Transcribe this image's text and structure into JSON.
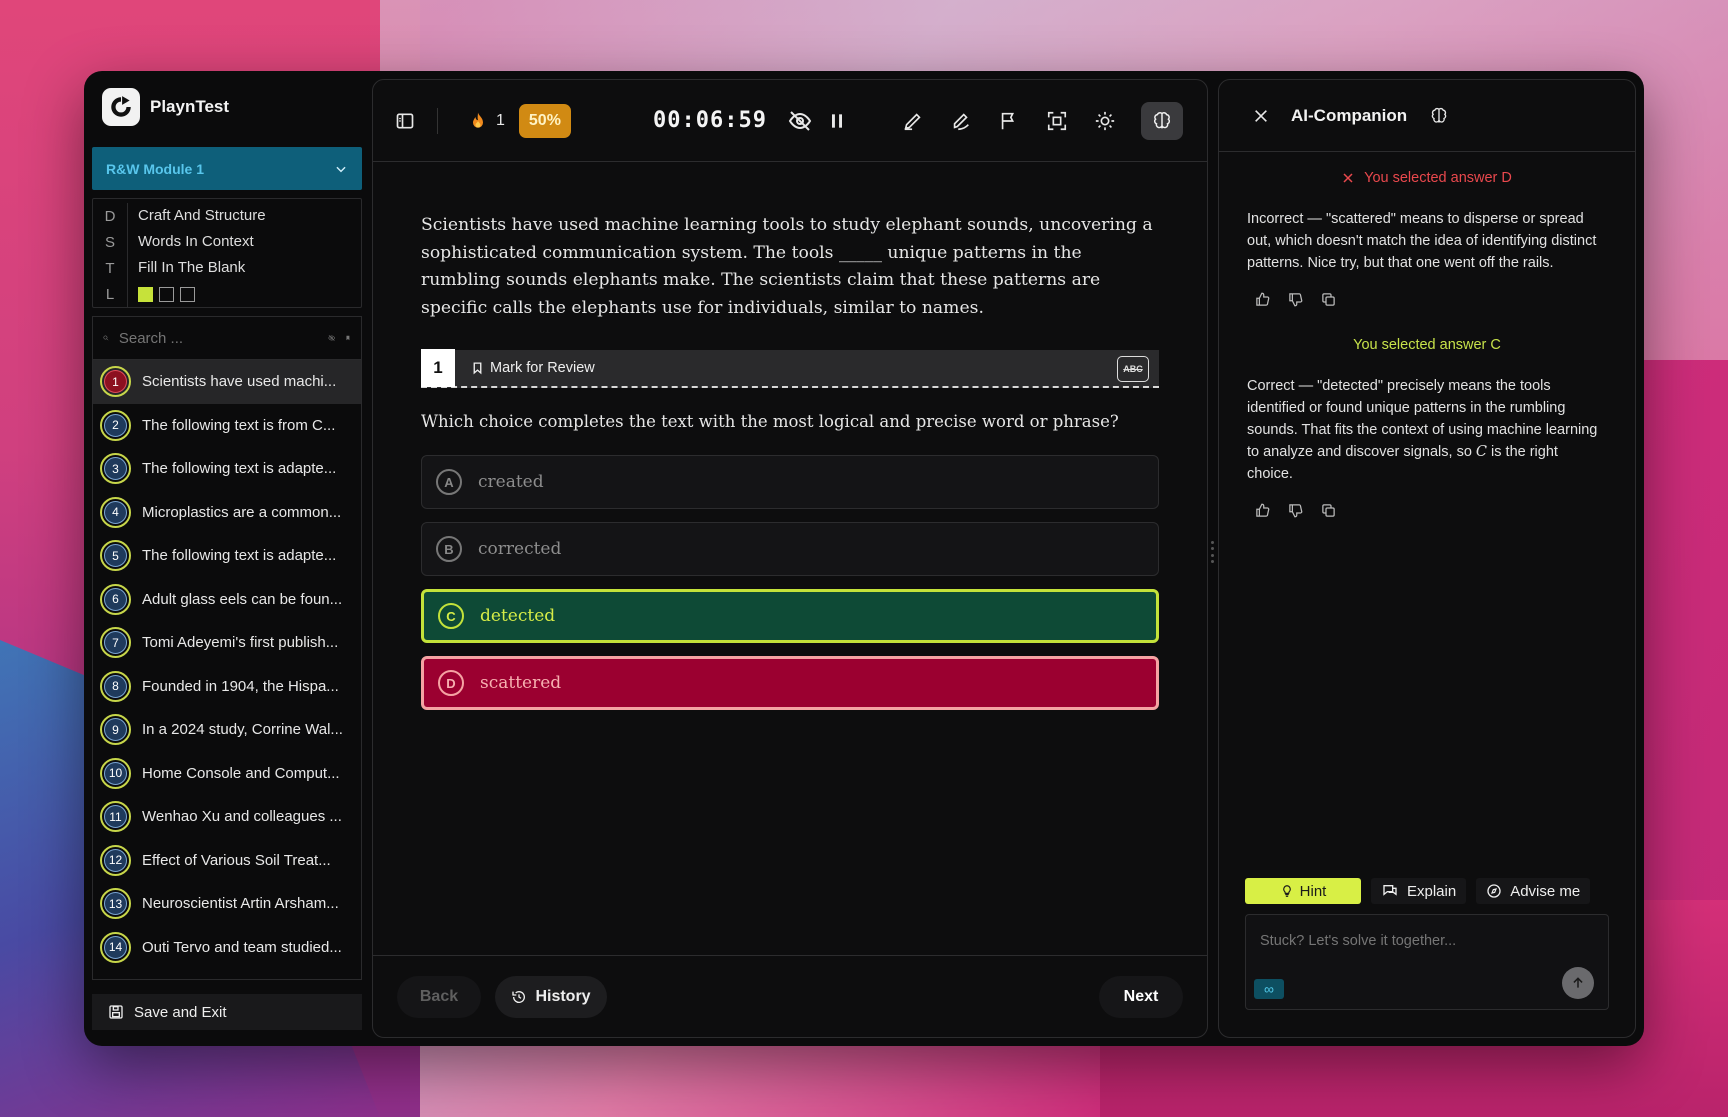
{
  "app": {
    "name": "PlaynTest"
  },
  "sidebar": {
    "module": "R&W Module 1",
    "dstl": [
      {
        "key": "D",
        "value": "Craft And Structure"
      },
      {
        "key": "S",
        "value": "Words In Context"
      },
      {
        "key": "T",
        "value": "Fill In The Blank"
      },
      {
        "key": "L",
        "value": ""
      }
    ],
    "level_colors": [
      "#c6e23a",
      "transparent",
      "transparent"
    ],
    "search_placeholder": "Search ...",
    "questions": [
      {
        "num": "1",
        "text": "Scientists have used machi..."
      },
      {
        "num": "2",
        "text": "The following text is from C..."
      },
      {
        "num": "3",
        "text": "The following text is adapte..."
      },
      {
        "num": "4",
        "text": "Microplastics are a common..."
      },
      {
        "num": "5",
        "text": "The following text is adapte..."
      },
      {
        "num": "6",
        "text": "Adult glass eels can be foun..."
      },
      {
        "num": "7",
        "text": "Tomi Adeyemi's first publish..."
      },
      {
        "num": "8",
        "text": "Founded in 1904, the Hispa..."
      },
      {
        "num": "9",
        "text": "In a 2024 study, Corrine Wal..."
      },
      {
        "num": "10",
        "text": "Home Console and Comput..."
      },
      {
        "num": "11",
        "text": "Wenhao Xu and colleagues ..."
      },
      {
        "num": "12",
        "text": "Effect of Various Soil Treat..."
      },
      {
        "num": "13",
        "text": "Neuroscientist Artin Arsham..."
      },
      {
        "num": "14",
        "text": "Outi Tervo and team studied..."
      }
    ],
    "save_exit": "Save and Exit"
  },
  "toolbar": {
    "streak": "1",
    "progress": "50%",
    "timer": "00:06:59"
  },
  "main": {
    "passage": "Scientists have used machine learning tools to study elephant sounds, uncovering a sophisticated communication system. The tools _____ unique patterns in the rumbling sounds elephants make. The scientists claim that these patterns are specific calls the elephants use for individuals, similar to names.",
    "question_number": "1",
    "mark_review": "Mark for Review",
    "abc_label": "ABC",
    "question": "Which choice completes the text with the most logical and precise word or phrase?",
    "choices": [
      {
        "letter": "A",
        "text": "created",
        "state": "dim"
      },
      {
        "letter": "B",
        "text": "corrected",
        "state": "dim"
      },
      {
        "letter": "C",
        "text": "detected",
        "state": "correct"
      },
      {
        "letter": "D",
        "text": "scattered",
        "state": "wrong"
      }
    ],
    "back": "Back",
    "history": "History",
    "next": "Next"
  },
  "ai": {
    "title": "AI-Companion",
    "selected_wrong": "You selected answer D",
    "msg_wrong": "Incorrect — \"scattered\" means to disperse or spread out, which doesn't match the idea of identifying distinct patterns. Nice try, but that one went off the rails.",
    "selected_right": "You selected answer C",
    "msg_right_a": "Correct — \"detected\" precisely means the tools identified or found unique patterns in the rumbling sounds. That fits the context of using machine learning to analyze and discover signals, so ",
    "msg_right_c": "C",
    "msg_right_b": " is the right choice.",
    "tabs": {
      "hint": "Hint",
      "explain": "Explain",
      "advise": "Advise me"
    },
    "input_placeholder": "Stuck? Let's solve it together...",
    "infinity": "∞"
  },
  "colors": {
    "correct_fill": "#0e4a36",
    "correct_border": "#c3e23a",
    "wrong_fill": "#9b0030",
    "wrong_border": "#f5a3a3",
    "accent_module": "#0e5f7a",
    "hint": "#d8ef45",
    "progress": "#d18a13"
  }
}
